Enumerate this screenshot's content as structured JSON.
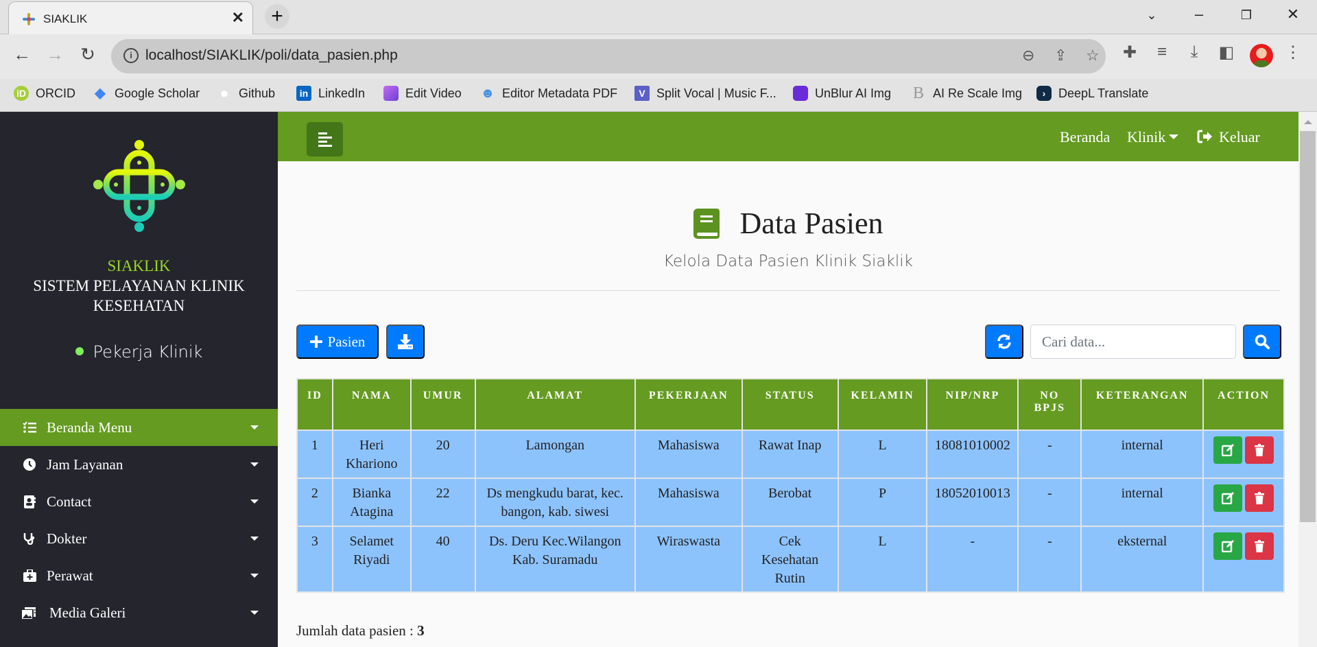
{
  "browser": {
    "tab_title": "SIAKLIK",
    "new_tab_label": "+",
    "url": "localhost/SIAKLIK/poli/data_pasien.php",
    "bookmarks": [
      {
        "label": "ORCID",
        "icon": "orcid-icon",
        "color": "#a6ce39",
        "glyph": "iD"
      },
      {
        "label": "Google Scholar",
        "icon": "google-scholar-icon",
        "color": "#4285f4",
        "glyph": "◆"
      },
      {
        "label": "Github",
        "icon": "github-icon",
        "color": "#ffffff",
        "glyph": "●"
      },
      {
        "label": "LinkedIn",
        "icon": "linkedin-icon",
        "color": "#0a66c2",
        "glyph": "in"
      },
      {
        "label": "Edit Video",
        "icon": "clapperboard-icon",
        "color": "#9b59f0",
        "glyph": "▮"
      },
      {
        "label": "Editor Metadata PDF",
        "icon": "users-icon",
        "color": "#4a90e2",
        "glyph": "☻"
      },
      {
        "label": "Split Vocal | Music F...",
        "icon": "split-vocal-icon",
        "color": "#5b5fc7",
        "glyph": "V"
      },
      {
        "label": "UnBlur AI Img",
        "icon": "unblur-icon",
        "color": "#6a2bd9",
        "glyph": "▮"
      },
      {
        "label": "AI Re Scale Img",
        "icon": "rescale-icon",
        "color": "#e3e3e3",
        "glyph": "B"
      },
      {
        "label": "DeepL Translate",
        "icon": "deepl-icon",
        "color": "#0f2b46",
        "glyph": "›"
      }
    ]
  },
  "sidebar": {
    "brand_name": "SIAKLIK",
    "brand_line1": "SISTEM PELAYANAN KLINIK",
    "brand_line2": "KESEHATAN",
    "role": "Pekerja Klinik",
    "menu": [
      {
        "label": "Beranda Menu",
        "icon": "list-check-icon",
        "active": true
      },
      {
        "label": "Jam Layanan",
        "icon": "clock-icon",
        "active": false
      },
      {
        "label": "Contact",
        "icon": "contact-card-icon",
        "active": false
      },
      {
        "label": "Dokter",
        "icon": "stethoscope-icon",
        "active": false
      },
      {
        "label": "Perawat",
        "icon": "medkit-icon",
        "active": false
      },
      {
        "label": "Media Galeri",
        "icon": "photo-gallery-icon",
        "active": false
      }
    ]
  },
  "topnav": {
    "home": "Beranda",
    "clinic": "Klinik",
    "logout": "Keluar"
  },
  "page": {
    "title": "Data Pasien",
    "subtitle": "Kelola Data Pasien Klinik Siaklik",
    "add_button": "Pasien",
    "search_placeholder": "Cari data...",
    "search_value": "",
    "summary_label": "Jumlah data pasien :",
    "summary_count": "3"
  },
  "table": {
    "headers": [
      "ID",
      "NAMA",
      "UMUR",
      "ALAMAT",
      "PEKERJAAN",
      "STATUS",
      "KELAMIN",
      "NIP/NRP",
      "NO BPJS",
      "KETERANGAN",
      "ACTION"
    ],
    "rows": [
      {
        "id": "1",
        "nama": "Heri Khariono",
        "umur": "20",
        "alamat": "Lamongan",
        "pekerjaan": "Mahasiswa",
        "status": "Rawat Inap",
        "kelamin": "L",
        "nip": "18081010002",
        "bpjs": "-",
        "keterangan": "internal"
      },
      {
        "id": "2",
        "nama": "Bianka Atagina",
        "umur": "22",
        "alamat": "Ds mengkudu barat, kec. bangon, kab. siwesi",
        "pekerjaan": "Mahasiswa",
        "status": "Berobat",
        "kelamin": "P",
        "nip": "18052010013",
        "bpjs": "-",
        "keterangan": "internal"
      },
      {
        "id": "3",
        "nama": "Selamet Riyadi",
        "umur": "40",
        "alamat": "Ds. Deru Kec.Wilangon Kab. Suramadu",
        "pekerjaan": "Wiraswasta",
        "status": "Cek Kesehatan Rutin",
        "kelamin": "L",
        "nip": "-",
        "bpjs": "-",
        "keterangan": "eksternal"
      }
    ]
  },
  "colors": {
    "primary_green": "#649b20",
    "sidebar_bg": "#24252d",
    "button_blue": "#007bff",
    "row_blue": "#8dc3fd",
    "edit_green": "#28a745",
    "delete_red": "#dc3545"
  }
}
